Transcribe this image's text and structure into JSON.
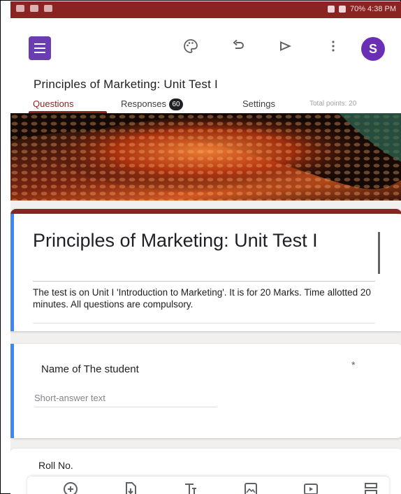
{
  "status_bar": {
    "right_text": "70% 4:38 PM"
  },
  "app": {
    "avatar_initial": "S",
    "form_title": "Principles of Marketing: Unit Test I",
    "accent_color": "#8a2422",
    "toolbar_icons": [
      "palette-icon",
      "undo-icon",
      "send-icon",
      "more-vert-icon"
    ]
  },
  "tabs": {
    "questions": "Questions",
    "responses": "Responses",
    "responses_count": "60",
    "settings": "Settings",
    "total_points": "Total points: 20"
  },
  "header": {
    "title": "Principles of Marketing: Unit Test I",
    "description": "The test is on Unit I 'Introduction to Marketing'. It is for 20 Marks. Time allotted  20 minutes. All questions are compulsory."
  },
  "questions": [
    {
      "title": "Name of The student",
      "required_mark": "*",
      "answer_placeholder": "Short-answer text"
    },
    {
      "title": "Roll No."
    }
  ],
  "bottom_toolbar": [
    "add-question-icon",
    "import-questions-icon",
    "add-title-icon",
    "add-image-icon",
    "add-video-icon",
    "add-section-icon"
  ]
}
